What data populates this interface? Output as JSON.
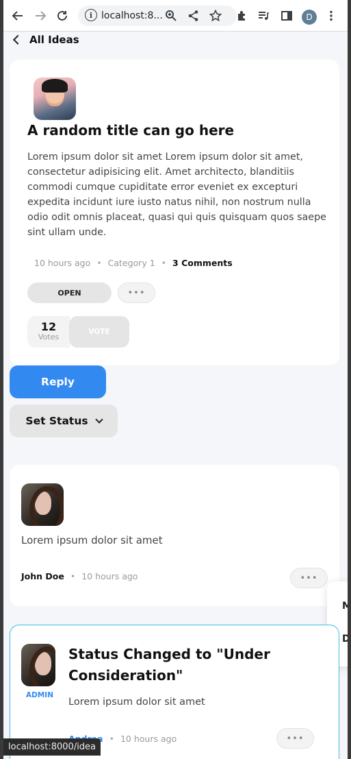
{
  "browser": {
    "url": "localhost:8...",
    "profile_initial": "D",
    "status_url": "localhost:8000/idea"
  },
  "nav": {
    "back_label": "All Ideas"
  },
  "idea": {
    "title": "A random title can go here",
    "body": "Lorem ipsum dolor sit amet Lorem ipsum dolor sit amet, consectetur adipisicing elit. Amet architecto, blanditiis commodi cumque cupiditate error eveniet ex excepturi expedita incidunt iure iusto natus nihil, non nostrum nulla odio odit omnis placeat, quasi qui quis quisquam quos saepe sint ullam unde.",
    "time": "10 hours ago",
    "category": "Category 1",
    "comments": "3 Comments",
    "status": "OPEN",
    "votes": "12",
    "votes_label": "Votes",
    "vote_button": "VOTE"
  },
  "actions": {
    "reply": "Reply",
    "set_status": "Set Status"
  },
  "comments": [
    {
      "text": "Lorem ipsum dolor sit amet",
      "author": "John Doe",
      "time": "10 hours ago"
    }
  ],
  "float_menu": {
    "item1": "M",
    "item2": "D"
  },
  "status_comment": {
    "title": "Status Changed to \"Under Consideration\"",
    "text": "Lorem ipsum dolor sit amet",
    "author": "Andrea",
    "time": "10 hours ago",
    "badge": "ADMIN",
    "border_color": "#39bfe0"
  },
  "colors": {
    "accent": "#328af1",
    "background": "#f5f6fa"
  }
}
